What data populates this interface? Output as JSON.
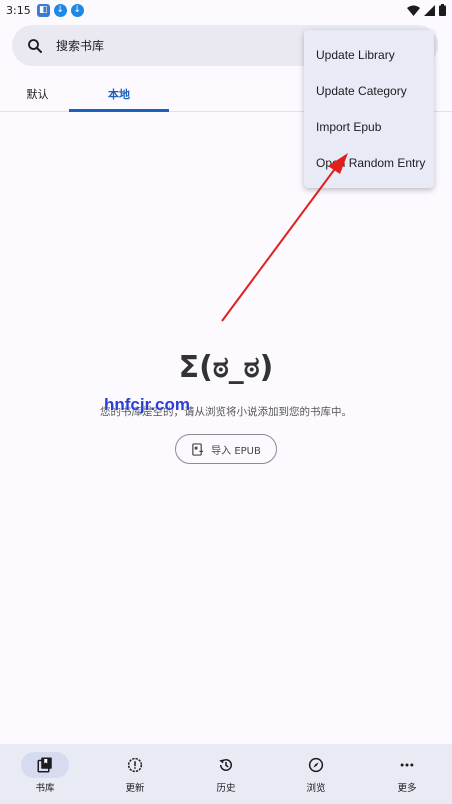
{
  "status_bar": {
    "time": "3:15"
  },
  "search": {
    "placeholder": "搜索书库"
  },
  "tabs": [
    {
      "label": "默认",
      "active": false
    },
    {
      "label": "本地",
      "active": true
    }
  ],
  "empty_state": {
    "face": "Σ(ಠ_ಠ)",
    "message": "您的书库是空的，请从浏览将小说添加到您的书库中。",
    "watermark": "hnfcjr.com",
    "import_button_label": "导入 EPUB"
  },
  "overflow_menu": {
    "items": [
      "Update Library",
      "Update Category",
      "Import Epub",
      "Open Random Entry"
    ]
  },
  "bottom_nav": [
    {
      "label": "书库",
      "icon": "library-icon",
      "active": true
    },
    {
      "label": "更新",
      "icon": "alert-circle-icon",
      "active": false
    },
    {
      "label": "历史",
      "icon": "history-icon",
      "active": false
    },
    {
      "label": "浏览",
      "icon": "compass-icon",
      "active": false
    },
    {
      "label": "更多",
      "icon": "more-horiz-icon",
      "active": false
    }
  ],
  "colors": {
    "accent": "#1b5fbd",
    "annotation_arrow": "#e0201e",
    "background": "#fcfaff",
    "nav_background": "#e9ebf4"
  }
}
